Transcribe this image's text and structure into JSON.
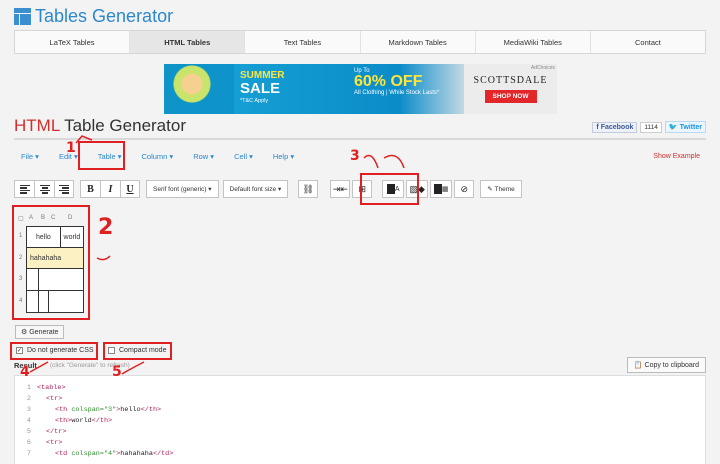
{
  "site": {
    "title": "Tables Generator"
  },
  "topnav": [
    "LaTeX Tables",
    "HTML Tables",
    "Text Tables",
    "Markdown Tables",
    "MediaWiki Tables",
    "Contact"
  ],
  "ad": {
    "summer": "SUMMER",
    "sale": "SALE",
    "tc": "*T&C Apply",
    "upto": "Up To",
    "pct": "60% OFF",
    "clothing": "All Clothing | While Stock Lasts*",
    "brand": "SCOTTSDALE",
    "shop": "SHOP NOW",
    "choices": "AdChoices"
  },
  "page": {
    "title_accent": "HTML",
    "title_rest": " Table Generator"
  },
  "social": {
    "facebook": "Facebook",
    "fb_count": "1114",
    "twitter": "Twitter"
  },
  "menubar": [
    "File ▾",
    "Edit ▾",
    "Table ▾",
    "Column ▾",
    "Row ▾",
    "Cell ▾",
    "Help ▾"
  ],
  "show_example": "Show Example",
  "toolbar": {
    "bold": "B",
    "italic": "I",
    "underline": "U",
    "font": "Serif font (generic)",
    "size": "Default font size",
    "theme": "Theme"
  },
  "editor": {
    "columns": [
      "A",
      "B",
      "C",
      "D"
    ],
    "rows": [
      "1",
      "2",
      "3",
      "4"
    ],
    "cells": {
      "hello": "hello",
      "world": "world",
      "hahahaha": "hahahaha"
    }
  },
  "generate_label": "Generate",
  "options": {
    "no_css": "Do not generate CSS",
    "compact": "Compact mode"
  },
  "result": {
    "label": "Result",
    "hint": "(click \"Generate\" to refresh)",
    "copy": "Copy to clipboard"
  },
  "code_lines": [
    {
      "n": "1",
      "indent": 0,
      "parts": [
        {
          "t": "<table>",
          "c": "tag"
        }
      ]
    },
    {
      "n": "2",
      "indent": 1,
      "parts": [
        {
          "t": "<tr>",
          "c": "tag"
        }
      ]
    },
    {
      "n": "3",
      "indent": 2,
      "parts": [
        {
          "t": "<th ",
          "c": "tag"
        },
        {
          "t": "colspan=\"3\"",
          "c": "attr"
        },
        {
          "t": ">",
          "c": "tag"
        },
        {
          "t": "hello",
          "c": "txt"
        },
        {
          "t": "</th>",
          "c": "tag"
        }
      ]
    },
    {
      "n": "4",
      "indent": 2,
      "parts": [
        {
          "t": "<th>",
          "c": "tag"
        },
        {
          "t": "world",
          "c": "txt"
        },
        {
          "t": "</th>",
          "c": "tag"
        }
      ]
    },
    {
      "n": "5",
      "indent": 1,
      "parts": [
        {
          "t": "</tr>",
          "c": "tag"
        }
      ]
    },
    {
      "n": "6",
      "indent": 1,
      "parts": [
        {
          "t": "<tr>",
          "c": "tag"
        }
      ]
    },
    {
      "n": "7",
      "indent": 2,
      "parts": [
        {
          "t": "<td ",
          "c": "tag"
        },
        {
          "t": "colspan=\"4\"",
          "c": "attr"
        },
        {
          "t": ">",
          "c": "tag"
        },
        {
          "t": "hahahaha",
          "c": "txt"
        },
        {
          "t": "</td>",
          "c": "tag"
        }
      ]
    }
  ],
  "annotations": [
    "1",
    "2",
    "3",
    "4",
    "5"
  ],
  "colors": {
    "accent": "#2b88cf",
    "red": "#d0302b",
    "highlight": "#e02020"
  }
}
